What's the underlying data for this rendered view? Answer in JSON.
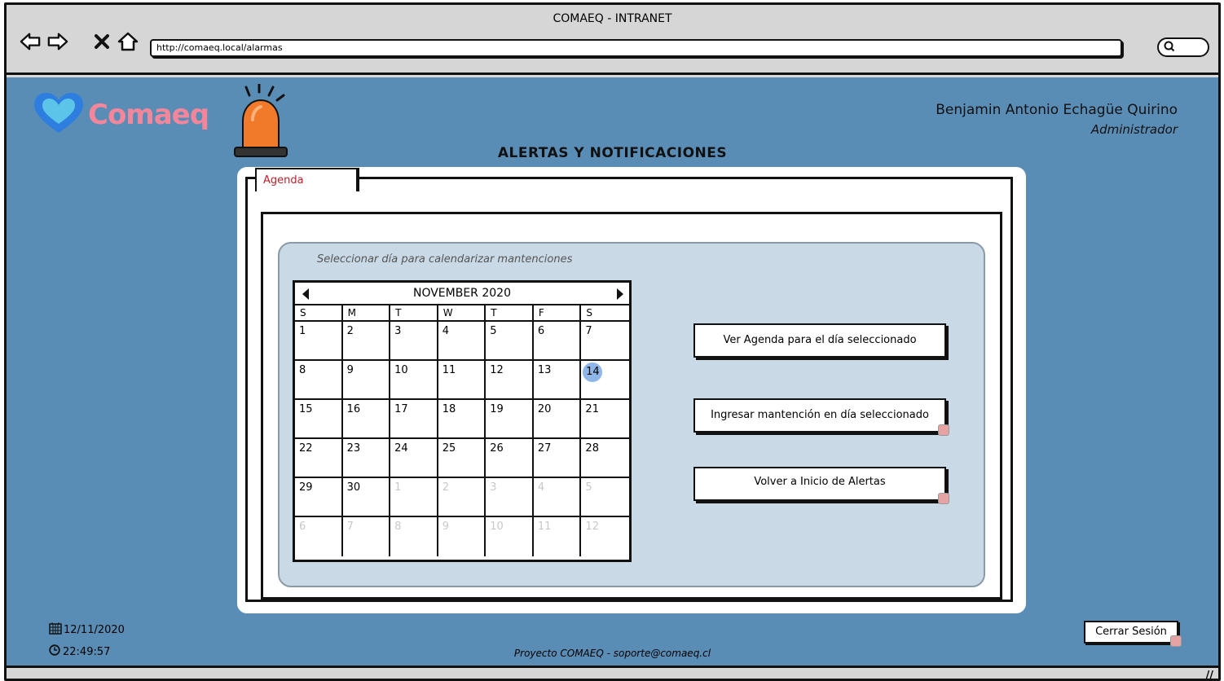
{
  "browser": {
    "window_title": "COMAEQ - INTRANET",
    "url": "http://comaeq.local/alarmas",
    "back_icon": "arrow-left-icon",
    "forward_icon": "arrow-right-icon",
    "stop_icon": "close-icon",
    "home_icon": "home-icon",
    "search_icon": "search-icon"
  },
  "header": {
    "logo_text": "Comaeq",
    "user_name": "Benjamin Antonio Echagüe Quirino",
    "user_role": "Administrador",
    "page_title": "ALERTAS Y NOTIFICACIONES"
  },
  "panel": {
    "tab_label": "Agenda",
    "instruction": "Seleccionar día para calendarizar mantenciones"
  },
  "calendar": {
    "month_label": "NOVEMBER 2020",
    "weekdays": [
      "S",
      "M",
      "T",
      "W",
      "T",
      "F",
      "S"
    ],
    "selected_day": "14",
    "rows": [
      [
        "1",
        "2",
        "3",
        "4",
        "5",
        "6",
        "7"
      ],
      [
        "8",
        "9",
        "10",
        "11",
        "12",
        "13",
        "14"
      ],
      [
        "15",
        "16",
        "17",
        "18",
        "19",
        "20",
        "21"
      ],
      [
        "22",
        "23",
        "24",
        "25",
        "26",
        "27",
        "28"
      ],
      [
        "29",
        "30",
        "1",
        "2",
        "3",
        "4",
        "5"
      ],
      [
        "6",
        "7",
        "8",
        "9",
        "10",
        "11",
        "12"
      ]
    ]
  },
  "actions": {
    "view_agenda": "Ver Agenda para el día seleccionado",
    "add_maintenance": "Ingresar mantención en día seleccionado",
    "back_to_alerts": "Volver a Inicio de Alertas"
  },
  "footer": {
    "date": "12/11/2020",
    "time": "22:49:57",
    "project_text": "Proyecto COMAEQ - soporte@comaeq.cl",
    "logout_label": "Cerrar Sesión"
  },
  "colors": {
    "app_background": "#5a8db5",
    "inner_box": "#c9d9e6",
    "selected_day": "#8eb6e8",
    "tab_text": "#c0202a",
    "logo_text": "#f4869c",
    "heart": "#2e7ee0",
    "siren": "#f07a2a"
  }
}
